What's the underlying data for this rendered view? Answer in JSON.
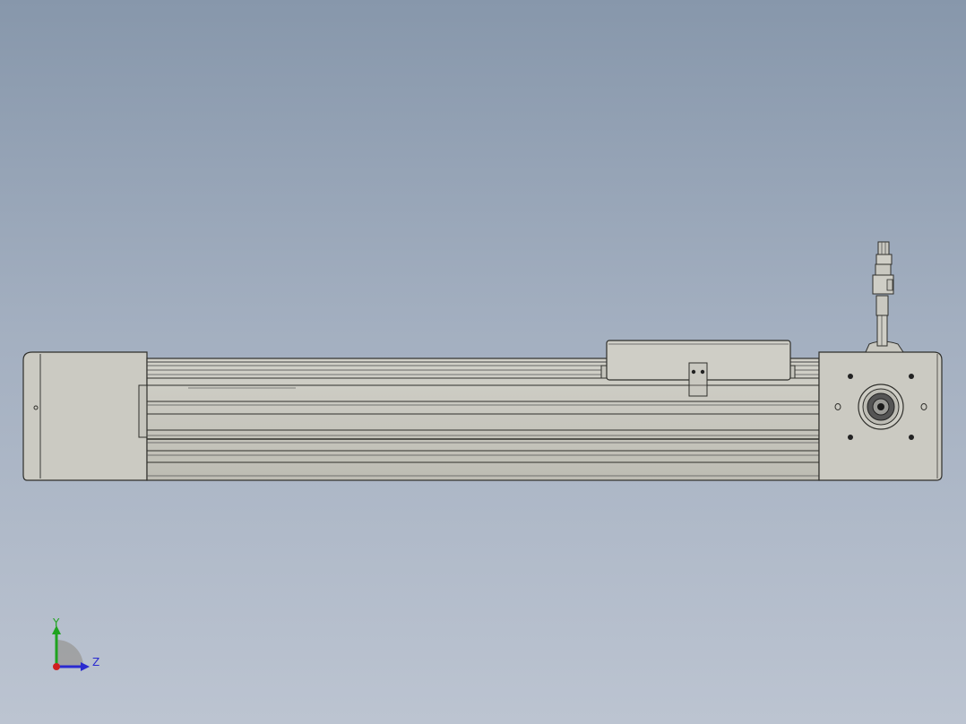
{
  "view": {
    "background_top": "#8797ab",
    "background_bottom": "#bcc4d1",
    "part_color": "#c8c7bf",
    "edge_color": "#3a3a36"
  },
  "triad": {
    "y_label": "Y",
    "z_label": "Z",
    "y_color": "#1fa31f",
    "z_color": "#2a2ad0",
    "x_color": "#d01f1f"
  }
}
